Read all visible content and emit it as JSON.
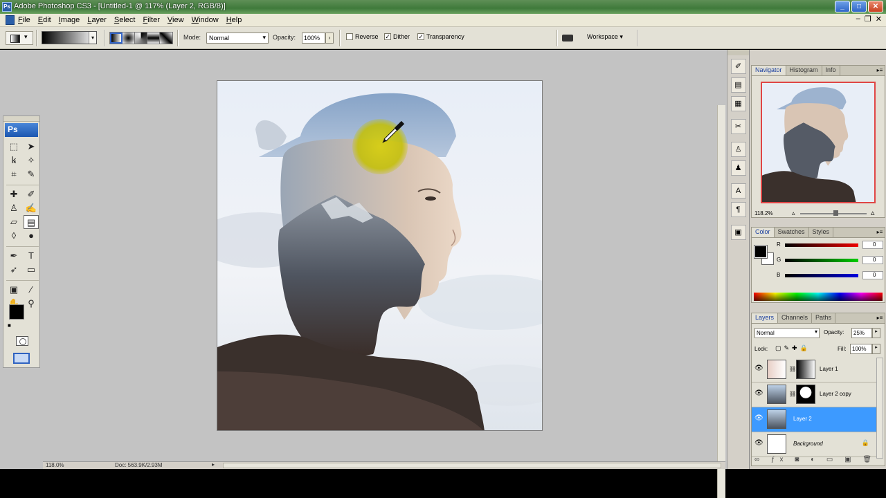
{
  "window": {
    "title": "Adobe Photoshop CS3 - [Untitled-1 @ 117% (Layer 2, RGB/8)]",
    "logo": "Ps"
  },
  "menu": [
    "File",
    "Edit",
    "Image",
    "Layer",
    "Select",
    "Filter",
    "View",
    "Window",
    "Help"
  ],
  "options": {
    "mode_label": "Mode:",
    "mode_value": "Normal",
    "opacity_label": "Opacity:",
    "opacity_value": "100%",
    "reverse_label": "Reverse",
    "dither_label": "Dither",
    "transparency_label": "Transparency",
    "workspace_label": "Workspace ▾"
  },
  "toolbox": {
    "logo": "Ps",
    "tools": [
      "marquee",
      "move",
      "lasso",
      "magic-wand",
      "crop",
      "slice",
      "healing",
      "brush",
      "stamp",
      "history-brush",
      "eraser",
      "gradient",
      "blur",
      "dodge",
      "pen",
      "type",
      "path-select",
      "shape",
      "notes",
      "eyedropper",
      "hand",
      "zoom"
    ],
    "active_tool": "gradient"
  },
  "status": {
    "zoom": "118.0%",
    "doc": "Doc: 563.9K/2.93M"
  },
  "navigator": {
    "tabs": [
      "Navigator",
      "Histogram",
      "Info"
    ],
    "zoom": "118.2%"
  },
  "color": {
    "tabs": [
      "Color",
      "Swatches",
      "Styles"
    ],
    "channels": [
      {
        "label": "R",
        "value": "0",
        "color": "#cc0000"
      },
      {
        "label": "G",
        "value": "0",
        "color": "#00aa00"
      },
      {
        "label": "B",
        "value": "0",
        "color": "#0000cc"
      }
    ]
  },
  "layers": {
    "tabs": [
      "Layers",
      "Channels",
      "Paths"
    ],
    "blend_mode": "Normal",
    "opacity_label": "Opacity:",
    "opacity_value": "25%",
    "lock_label": "Lock:",
    "fill_label": "Fill:",
    "fill_value": "100%",
    "items": [
      {
        "name": "Layer 1",
        "selected": false
      },
      {
        "name": "Layer 2 copy",
        "selected": false
      },
      {
        "name": "Layer 2",
        "selected": true
      },
      {
        "name": "Background",
        "selected": false
      }
    ]
  },
  "colors": {
    "accent_selected": "#3d9aff",
    "workspace_bg": "#c3c3c3"
  }
}
